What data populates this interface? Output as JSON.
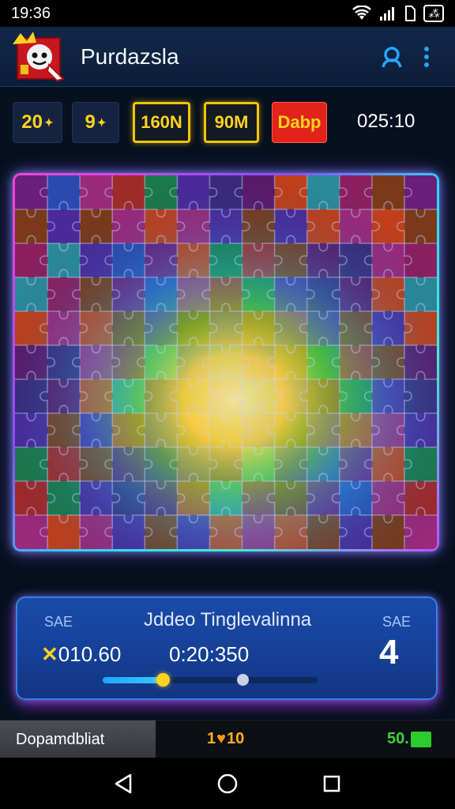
{
  "status_bar": {
    "time": "19:36",
    "battery_label": "⁂",
    "icons": [
      "wifi-icon",
      "signal-icon",
      "sim-icon",
      "battery-icon"
    ]
  },
  "app_bar": {
    "title": "Purdazsla",
    "logo": "game-mascot-logo",
    "actions": [
      "user-search-icon",
      "more-vert-icon"
    ]
  },
  "stats": {
    "s1": "20",
    "s2": "9",
    "s3": "160N",
    "s4": "90M",
    "s5": "Dabp",
    "time": "025:10"
  },
  "puzzle": {
    "rows": 11,
    "cols": 13,
    "border_colors": [
      "#ff3fd7",
      "#8a4dff",
      "#2bd6ff",
      "#3ef0d0"
    ]
  },
  "info_panel": {
    "left_label": "SAE",
    "right_label": "SAE",
    "title": "Jddeo Tinglevalinna",
    "score_mark": "✕",
    "score": "010.60",
    "timer": "0:20:350",
    "big_value": "4",
    "slider_progress": 0.28,
    "slider_secondary": 0.65
  },
  "bottom_bar": {
    "left_label": "Dopamdbliat",
    "gems_prefix": "1",
    "gem_icon": "gem-icon",
    "gems_suffix": "10",
    "energy": "50."
  },
  "nav_bar": {
    "buttons": [
      "back-icon",
      "home-icon",
      "recents-icon"
    ]
  },
  "colors": {
    "accent_yellow": "#ffd21f",
    "accent_red": "#e2231a",
    "panel_blue": "#1a4ba8",
    "energy_green": "#2dcc2d"
  }
}
